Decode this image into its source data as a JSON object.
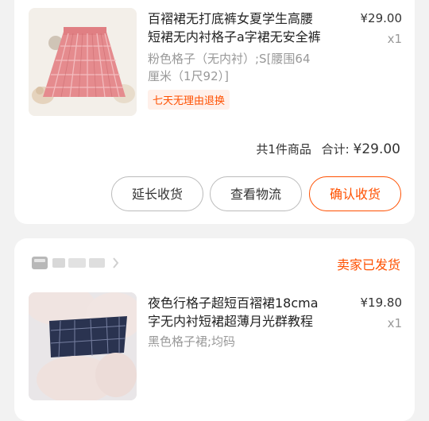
{
  "orders": [
    {
      "item": {
        "title_line1": "百褶裙无打底裤女夏学生高腰",
        "title_line2": "短裙无内衬格子a字裙无安全裤",
        "spec_line1": "粉色格子（无内衬）;S[腰围64",
        "spec_line2": "厘米（1尺92）]",
        "price": "¥29.00",
        "qty": "x1",
        "tag": "七天无理由退换",
        "image_icon": "pink-plaid-skirt-photo"
      },
      "summary": {
        "count_text": "共1件商品",
        "total_label": "合计:",
        "total_amount": "¥29.00"
      },
      "buttons": {
        "extend": "延长收货",
        "logistics": "查看物流",
        "confirm": "确认收货"
      }
    },
    {
      "shop_icon": "shop-icon",
      "status": "卖家已发货",
      "item": {
        "title_line1": "夜色行格子超短百褶裙18cma",
        "title_line2": "字无内衬短裙超薄月光群教程",
        "spec_line1": "黑色格子裙;均码",
        "price": "¥19.80",
        "qty": "x1",
        "image_icon": "navy-plaid-skirt-photo"
      }
    }
  ],
  "colors": {
    "accent": "#ff5000",
    "background": "#f2f2f2",
    "card": "#ffffff",
    "muted_text": "#999999"
  }
}
